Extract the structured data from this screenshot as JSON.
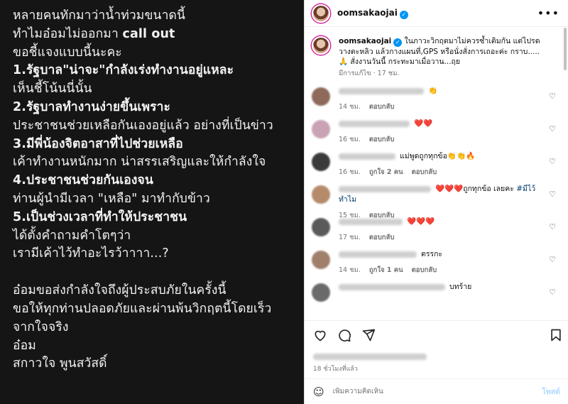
{
  "image_text": {
    "lines": [
      "หลายคนทักมาว่าน้ำท่วมขนาดนี้",
      "ทำไมอ๋อมไม่ออกมา call out",
      "ขอชี้แจงแบบนี้นะคะ",
      "1.รัฐบาล\"น่าจะ\"กำลังเร่งทำงานอยู่แหละ",
      "เห็นชี้โน้นนี่นั้น",
      "2.รัฐบาลทำงานง่ายขึ้นเพราะ",
      "ประชาชนช่วยเหลือกันเองอยู่แล้ว อย่างที่เป็นข่าว",
      "3.มีพี่น้องจิตอาสาที่ไปช่วยเหลือ",
      "เค้าทำงานหนักมาก น่าสรรเสริญและให้กำลังใจ",
      "4.ประชาชนช่วยกันเองจน",
      "ท่านผู้นำมีเวลา \"เหลือ\" มาทำกับข้าว",
      "5.เป็นช่วงเวลาที่ทำให้ประชาชน",
      "ได้ตั้งคำถามคำโตๆว่า",
      "เรามีเค้าไว้ทำอะไรว้าาาา...?",
      "",
      "อ๋อมขอส่งกำลังใจถึงผู้ประสบภัยในครั้งนี้",
      "ขอให้ทุกท่านปลอดภัยและผ่านพ้นวิกฤตนี้โดยเร็ว",
      "จากใจจริง",
      "อ๋อม",
      "สกาวใจ พูนสวัสดิ์"
    ]
  },
  "header": {
    "username": "oomsakaojai",
    "more_label": "•••"
  },
  "caption": {
    "username": "oomsakaojai",
    "text": "ในภาวะวิกฤตมาไม่ควรซ้ำเติมกัน แต่ไปรดวางตะหลิว แล้วกางแผนที่,GPS หรือนั่งสั่งการเถอะค่ะ กราบ.....🙏 สั่งงานวันนี้ กระทะมาเมื่อวาน...ฤย",
    "edited": "มีการแก้ไข",
    "time": "17 ชม."
  },
  "comments": [
    {
      "text": "👏",
      "tag": "",
      "time": "14 ชม.",
      "likes": "",
      "reply": "ตอบกลับ",
      "av": "#8d6a5a"
    },
    {
      "text": "❤️❤️",
      "tag": "",
      "time": "16 ชม.",
      "likes": "",
      "reply": "ตอบกลับ",
      "av": "#c9a2b4"
    },
    {
      "text": "แม่พูดถูกทุกข้อ👏👏🔥",
      "tag": "",
      "time": "16 ชม.",
      "likes": "ถูกใจ 2 คน",
      "reply": "ตอบกลับ",
      "av": "#3a3a3a"
    },
    {
      "text": "❤️❤️❤️ถูกทุกข้อ เลยคะ ",
      "tag": "#มีไว้ทำไม",
      "time": "15 ชม.",
      "likes": "",
      "reply": "ตอบกลับ",
      "av": "#b58b6b"
    },
    {
      "text": "❤️❤️❤️",
      "tag": "",
      "time": "17 ชม.",
      "likes": "",
      "reply": "ตอบกลับ",
      "av": "#5a5a5a"
    },
    {
      "text": "ตรรกะ",
      "tag": "",
      "time": "14 ชม.",
      "likes": "ถูกใจ 1 คน",
      "reply": "ตอบกลับ",
      "av": "#a07f6b"
    },
    {
      "text": "บทร้าย",
      "tag": "",
      "time": "",
      "likes": "",
      "reply": "",
      "av": "#6a6a6a"
    }
  ],
  "time_ago": "18 ชั่วโมงที่แล้ว",
  "add_comment": {
    "placeholder": "เพิ่มความคิดเห็น",
    "post_label": "โพสต์"
  },
  "colors": {
    "left_bg": "#151515",
    "link": "#00376b",
    "verified": "#0095f6"
  }
}
